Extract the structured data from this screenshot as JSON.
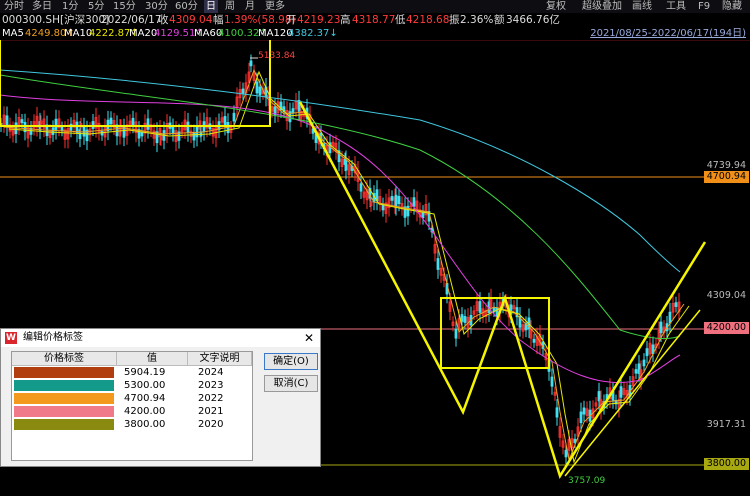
{
  "toolbar": {
    "periods": [
      "分时",
      "多日",
      "1分",
      "5分",
      "15分",
      "30分",
      "60分",
      "日",
      "周",
      "月",
      "更多"
    ],
    "active": "日",
    "right": [
      "复权",
      "超级叠加",
      "画线",
      "工具",
      "F9",
      "隐藏"
    ]
  },
  "quote": {
    "code": "000300.SH[沪深300]",
    "date": "2022/06/17",
    "close_label": "收",
    "close": "4309.04",
    "chg_label": "幅",
    "chg": "1.39%(58.98)",
    "open_label": "开",
    "open": "4219.23",
    "high_label": "高",
    "high": "4318.77",
    "low_label": "低",
    "low": "4218.68",
    "amp_label": "振",
    "amp": "2.36%",
    "amount_label": "额",
    "amount": "3466.76亿"
  },
  "ma": {
    "items": [
      {
        "label": "MA5",
        "value": "4249.80↑",
        "color": "#ffffff",
        "vcolor": "#f0a020"
      },
      {
        "label": "MA10",
        "value": "4222.87↑",
        "color": "#ffffff",
        "vcolor": "#e8e800"
      },
      {
        "label": "MA20",
        "value": "4129.51↑",
        "color": "#ffffff",
        "vcolor": "#e040e0"
      },
      {
        "label": "MA60",
        "value": "4100.32↑",
        "color": "#ffffff",
        "vcolor": "#40d040"
      },
      {
        "label": "MA120",
        "value": "4382.37↓",
        "color": "#ffffff",
        "vcolor": "#40c8e0"
      }
    ],
    "range": "2021/08/25-2022/06/17(194日)"
  },
  "chart": {
    "high_label": "5133.84",
    "low_label": "3757.09",
    "levels": [
      {
        "price": "4739.94",
        "kind": "axis"
      },
      {
        "price": "4700.94",
        "kind": "tag",
        "color": "#f09018"
      },
      {
        "price": "4309.04",
        "kind": "axis"
      },
      {
        "price": "4200.00",
        "kind": "tag",
        "color": "#f07080"
      },
      {
        "price": "3917.31",
        "kind": "axis"
      },
      {
        "price": "3800.00",
        "kind": "tag",
        "color": "#a8a810"
      }
    ]
  },
  "dialog": {
    "title": "编辑价格标签",
    "headers": [
      "价格标签",
      "值",
      "文字说明"
    ],
    "rows": [
      {
        "color": "#b13e0f",
        "value": "5904.19",
        "note": "2024"
      },
      {
        "color": "#139a8a",
        "value": "5300.00",
        "note": "2023"
      },
      {
        "color": "#f39a1e",
        "value": "4700.94",
        "note": "2022"
      },
      {
        "color": "#f07a8a",
        "value": "4200.00",
        "note": "2021"
      },
      {
        "color": "#8a8a10",
        "value": "3800.00",
        "note": "2020"
      }
    ],
    "ok": "确定(O)",
    "cancel": "取消(C)"
  }
}
